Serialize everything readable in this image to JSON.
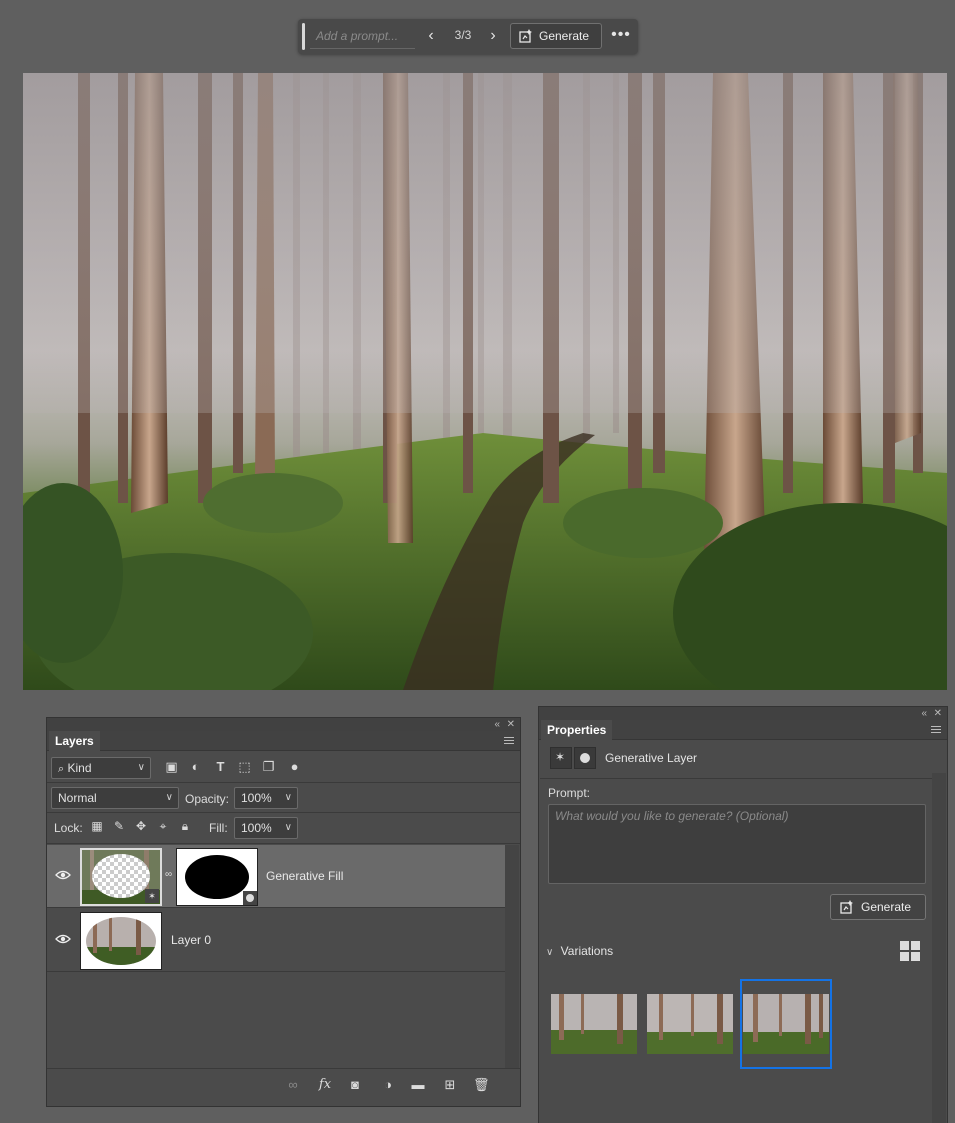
{
  "taskbar": {
    "prompt_placeholder": "Add a prompt...",
    "counter": "3/3",
    "generate_label": "Generate",
    "prev_icon": "chevron-left-icon",
    "next_icon": "chevron-right-icon",
    "more_icon": "more-icon"
  },
  "layers_panel": {
    "tab_label": "Layers",
    "filter_kind": "Kind",
    "blend_mode": "Normal",
    "opacity_label": "Opacity:",
    "opacity_value": "100%",
    "lock_label": "Lock:",
    "fill_label": "Fill:",
    "fill_value": "100%",
    "layers": [
      {
        "name": "Generative Fill",
        "selected": true
      },
      {
        "name": "Layer 0",
        "selected": false
      }
    ]
  },
  "properties_panel": {
    "tab_label": "Properties",
    "layer_type": "Generative Layer",
    "prompt_label": "Prompt:",
    "prompt_placeholder": "What would you like to generate? (Optional)",
    "generate_label": "Generate",
    "variations_label": "Variations",
    "selected_variation": 3,
    "variation_count": 3
  },
  "colors": {
    "selection_blue": "#1473e6",
    "panel_bg": "#4b4b4b",
    "app_bg": "#5f5f5f"
  }
}
